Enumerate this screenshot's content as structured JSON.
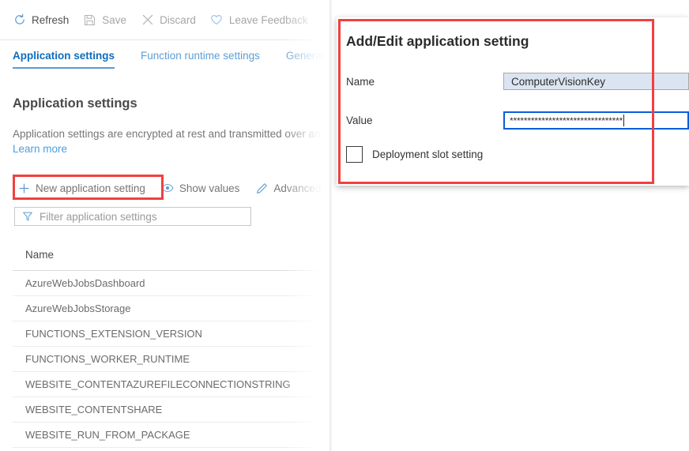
{
  "command_bar": {
    "buttons": [
      {
        "label": "Refresh",
        "icon": "refresh-icon",
        "enabled": true
      },
      {
        "label": "Save",
        "icon": "save-icon",
        "enabled": false
      },
      {
        "label": "Discard",
        "icon": "close-icon",
        "enabled": false
      },
      {
        "label": "Leave Feedback",
        "icon": "heart-icon",
        "enabled": false
      }
    ]
  },
  "tabs": [
    {
      "label": "Application settings",
      "active": true
    },
    {
      "label": "Function runtime settings",
      "active": false
    },
    {
      "label": "General",
      "active": false
    }
  ],
  "section": {
    "title": "Application settings",
    "description": "Application settings are encrypted at rest and transmitted over an",
    "learn_more": "Learn more"
  },
  "actions": [
    {
      "label": "New application setting",
      "icon": "plus-icon"
    },
    {
      "label": "Show values",
      "icon": "eye-icon"
    },
    {
      "label": "Advanced",
      "icon": "pencil-icon"
    }
  ],
  "filter": {
    "placeholder": "Filter application settings",
    "value": "",
    "icon": "filter-icon"
  },
  "table": {
    "columns": [
      "Name"
    ],
    "rows": [
      "AzureWebJobsDashboard",
      "AzureWebJobsStorage",
      "FUNCTIONS_EXTENSION_VERSION",
      "FUNCTIONS_WORKER_RUNTIME",
      "WEBSITE_CONTENTAZUREFILECONNECTIONSTRING",
      "WEBSITE_CONTENTSHARE",
      "WEBSITE_RUN_FROM_PACKAGE"
    ]
  },
  "dialog": {
    "title": "Add/Edit application setting",
    "name_label": "Name",
    "name_value": "ComputerVisionKey",
    "value_label": "Value",
    "value_value": "********************************",
    "checkbox_label": "Deployment slot setting",
    "checkbox_checked": false
  },
  "annotations": {
    "accent_color": "#f04040",
    "focus_border_color": "#0a5ed8",
    "link_color": "#4b9fe0",
    "tab_active_color": "#0f6cbd"
  }
}
